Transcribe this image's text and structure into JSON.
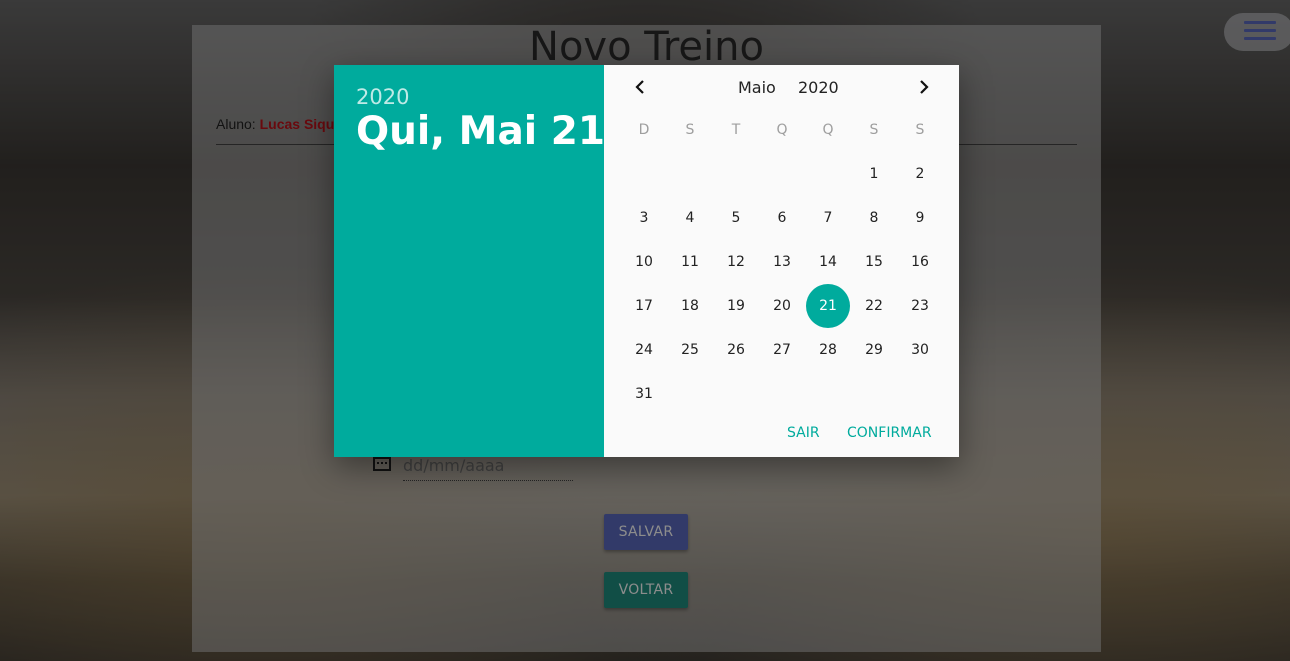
{
  "page": {
    "title": "Novo Treino",
    "aluno_label": "Aluno:",
    "aluno_name": "Lucas Siqu"
  },
  "form": {
    "date_placeholder": "dd/mm/aaaa",
    "save_label": "SALVAR",
    "back_label": "VOLTAR"
  },
  "datepicker": {
    "header_year": "2020",
    "header_date": "Qui, Mai 21",
    "month": "Maio",
    "year": "2020",
    "weekdays": [
      "D",
      "S",
      "T",
      "Q",
      "Q",
      "S",
      "S"
    ],
    "first_weekday_index": 5,
    "days_in_month": 31,
    "selected_day": 21,
    "cancel_label": "SAIR",
    "confirm_label": "CONFIRMAR",
    "accent_color": "#00ab9d"
  },
  "icons": {
    "menu": "hamburger-menu-icon",
    "calendar": "calendar-icon",
    "prev": "chevron-left-icon",
    "next": "chevron-right-icon"
  }
}
